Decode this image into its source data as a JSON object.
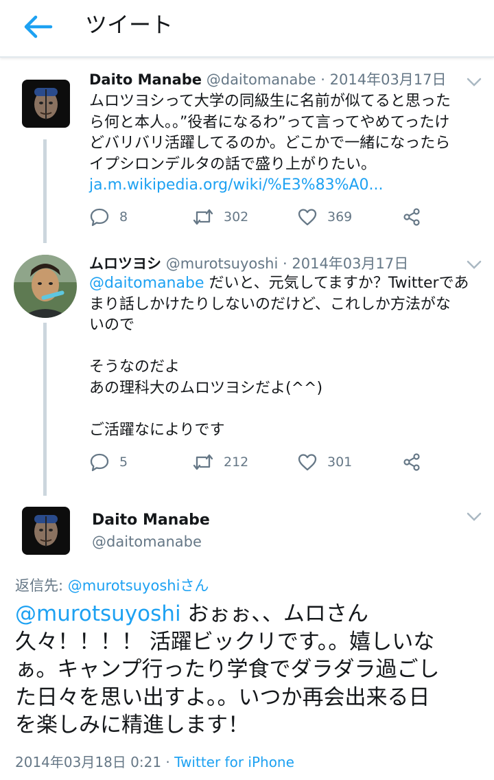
{
  "header": {
    "title": "ツイート"
  },
  "tweets": [
    {
      "name": "Daito Manabe",
      "handle": "@daitomanabe",
      "sep": " · ",
      "date": "2014年03月17日",
      "lines": [
        "ムロツヨシって大学の同級生に名前が似てると思った",
        "ら何と本人。。”役者になるわ”って言ってやめてったけ",
        "どバリバリ活躍してるのか。どこかで一緒になったら",
        "イプシロンデルタの話で盛り上がりたい。"
      ],
      "link": "ja.m.wikipedia.org/wiki/%E3%83%A0...",
      "replies": "8",
      "retweets": "302",
      "likes": "369"
    },
    {
      "name": "ムロツヨシ",
      "handle": "@murotsuyoshi",
      "sep": " · ",
      "date": "2014年03月17日",
      "mention": "@daitomanabe",
      "first_line_rest": " だいと、元気してますか？Twitterであ",
      "lines": [
        "まり話しかけたりしないのだけど、これしか方法がな",
        "いので",
        "",
        "そうなのだよ",
        "あの理科大のムロツヨシだよ(^^)",
        "",
        "ご活躍なによりです"
      ],
      "replies": "5",
      "retweets": "212",
      "likes": "301"
    }
  ],
  "main_tweet": {
    "name": "Daito Manabe",
    "handle": "@daitomanabe",
    "reply_to_label": "返信先: ",
    "reply_to_user": "@murotsuyoshiさん",
    "mention": "@murotsuyoshi",
    "first_line_rest": " おぉぉ、、ムロさん",
    "lines": [
      "久々！！！！ 活躍ビックリです。。嬉しいな",
      "ぁ。キャンプ行ったり学食でダラダラ過ごし",
      "た日々を思い出すよ。。いつか再会出来る日",
      "を楽しみに精進します！"
    ],
    "timestamp": "2014年03月18日 0:21",
    "meta_sep": " · ",
    "client": "Twitter for iPhone"
  },
  "colors": {
    "accent": "#1da1f2",
    "muted": "#657786",
    "thread": "#ccd6dd"
  },
  "icons": [
    "back-arrow-icon",
    "chevron-down-icon",
    "reply-icon",
    "retweet-icon",
    "like-icon",
    "share-icon"
  ]
}
